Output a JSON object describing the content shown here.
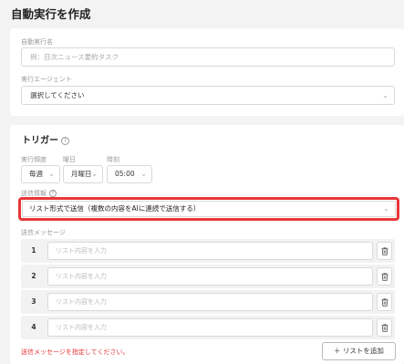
{
  "page_title": "自動実行を作成",
  "basic": {
    "name_label": "自動実行名",
    "name_placeholder": "例：日次ニュース要約タスク",
    "agent_label": "実行エージェント",
    "agent_value": "選択してください"
  },
  "trigger": {
    "title": "トリガー",
    "help_icon": "?",
    "frequency_label": "実行頻度",
    "frequency_value": "毎週",
    "weekday_label": "曜日",
    "weekday_value": "月曜日",
    "time_label": "時刻",
    "time_value": "05:00",
    "send_info_label": "送信情報",
    "send_info_value": "リスト形式で送信（複数の内容をAIに連続で送信する）"
  },
  "messages": {
    "label": "送信メッセージ",
    "rows": [
      {
        "num": "1",
        "placeholder": "リスト内容を入力"
      },
      {
        "num": "2",
        "placeholder": "リスト内容を入力"
      },
      {
        "num": "3",
        "placeholder": "リスト内容を入力"
      },
      {
        "num": "4",
        "placeholder": "リスト内容を入力"
      }
    ],
    "error": "送信メッセージを指定してください。",
    "add_button": "＋ リストを追加"
  },
  "colors": {
    "highlight": "#e8363a",
    "error": "#e8363a"
  }
}
